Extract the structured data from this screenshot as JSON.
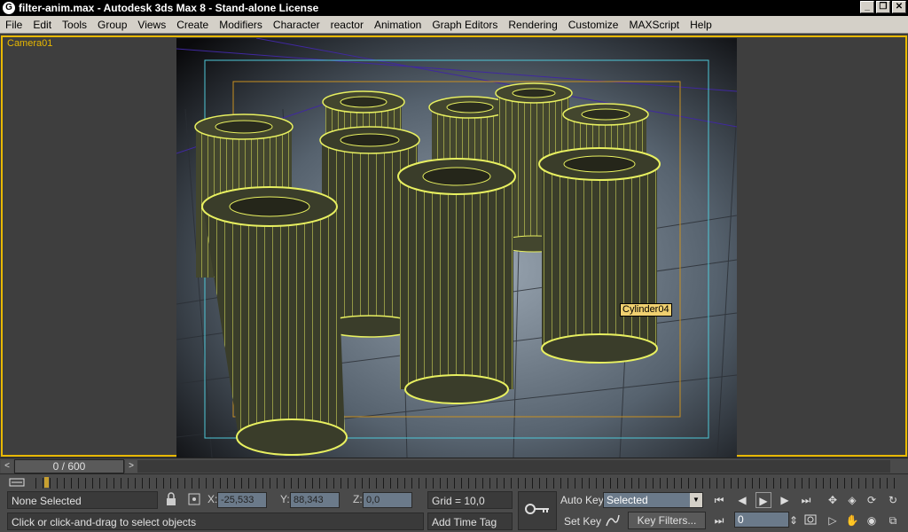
{
  "window": {
    "title": "filter-anim.max - Autodesk 3ds Max 8  - Stand-alone License",
    "app_icon_glyph": "G",
    "minimize_glyph": "_",
    "maximize_glyph": "❐",
    "close_glyph": "✕"
  },
  "menu": [
    "File",
    "Edit",
    "Tools",
    "Group",
    "Views",
    "Create",
    "Modifiers",
    "Character",
    "reactor",
    "Animation",
    "Graph Editors",
    "Rendering",
    "Customize",
    "MAXScript",
    "Help"
  ],
  "viewport": {
    "label": "Camera01",
    "tooltip": "Cylinder04",
    "border_color": "#e8b800",
    "wire_color": "#e8f060",
    "safe_frame_color": "#4fc8d8"
  },
  "timeslider": {
    "value": "0 / 600",
    "left_arrow": "<",
    "right_arrow": ">"
  },
  "trackbar": {
    "filter_icon": "filter-icon"
  },
  "status": {
    "selection": "None Selected",
    "prompt": "Click or click-and-drag to select objects",
    "x_label": "X:",
    "y_label": "Y:",
    "z_label": "Z:",
    "x_value": "-25,533",
    "y_value": "88,343",
    "z_value": "0,0",
    "grid": "Grid = 10,0",
    "add_time_tag": "Add Time Tag",
    "auto_key": "Auto Key",
    "set_key": "Set Key",
    "selected_option": "Selected",
    "key_filters": "Key Filters...",
    "frame": "0"
  }
}
